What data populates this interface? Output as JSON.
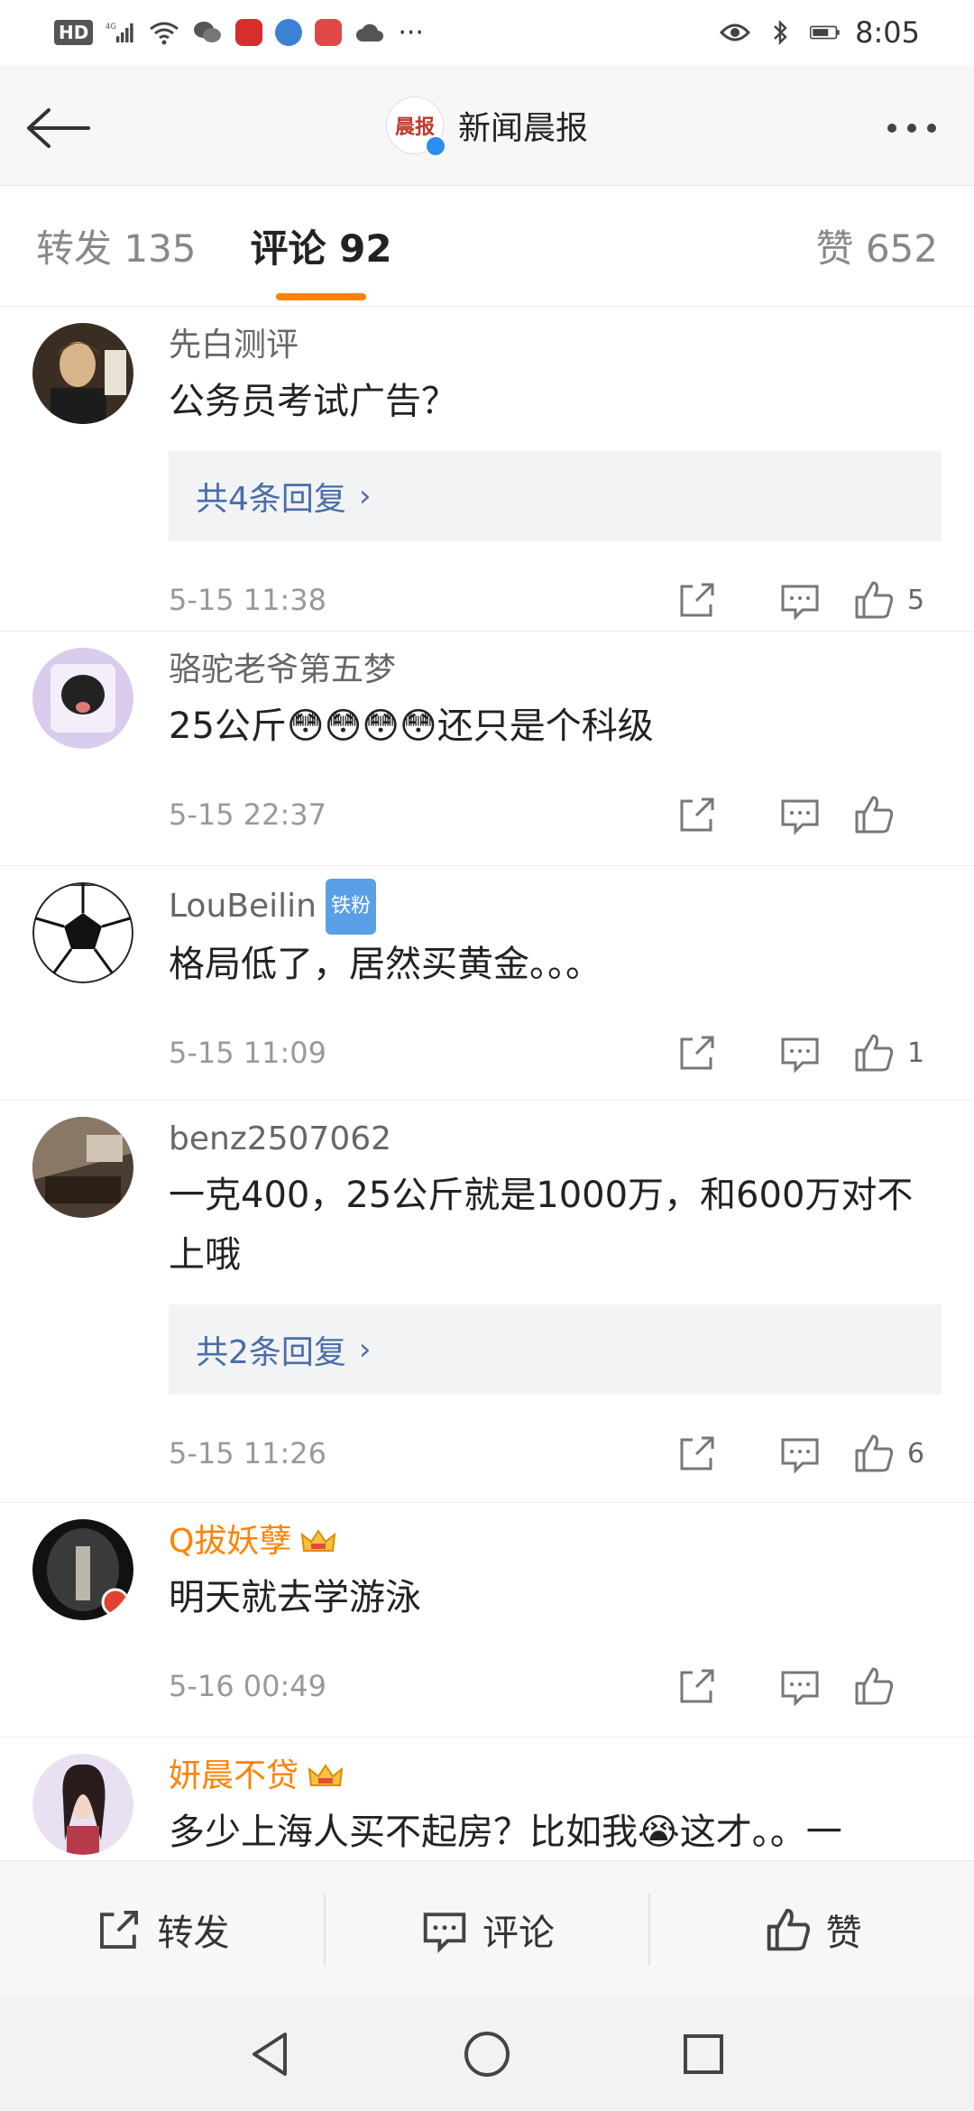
{
  "status_bar": {
    "network_badge": "HD",
    "network_type": "4G",
    "time": "8:05",
    "overflow": "···"
  },
  "header": {
    "title": "新闻晨报",
    "logo_text": "晨报"
  },
  "tabs": {
    "repost": "转发 135",
    "comments": "评论 92",
    "likes": "赞 652"
  },
  "comments": [
    {
      "user": "先白测评",
      "text": "公务员考试广告？",
      "replies": "共4条回复",
      "time": "5-15 11:38",
      "likes": "5"
    },
    {
      "user": "骆驼老爷第五梦",
      "text": "25公斤😳😳😳😳还只是个科级",
      "replies": "",
      "time": "5-15 22:37",
      "likes": ""
    },
    {
      "user": "LouBeilin",
      "badge": "铁粉",
      "text": "格局低了，居然买黄金。。。",
      "replies": "",
      "time": "5-15 11:09",
      "likes": "1"
    },
    {
      "user": "benz2507062",
      "text": "一克400，25公斤就是1000万，和600万对不上哦",
      "replies": "共2条回复",
      "time": "5-15 11:26",
      "likes": "6"
    },
    {
      "user": "Q拔妖孽",
      "text": "明天就去学游泳",
      "replies": "",
      "time": "5-16 00:49",
      "likes": ""
    },
    {
      "user": "妍晨不贷",
      "text": "多少上海人买不起房？比如我😭这才。。一",
      "replies": "",
      "time": "",
      "likes": ""
    }
  ],
  "bottom_bar": {
    "repost": "转发",
    "comment": "评论",
    "like": "赞"
  },
  "colors": {
    "accent": "#ff8200",
    "link": "#4a6ea8",
    "vip_name": "#ff8200"
  }
}
